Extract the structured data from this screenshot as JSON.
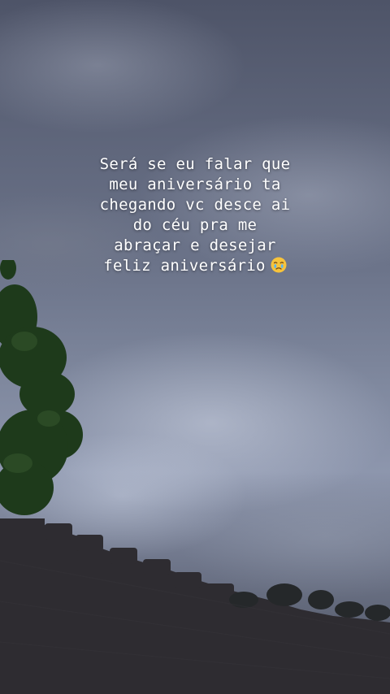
{
  "story": {
    "caption_lines": [
      "Será se eu falar que",
      "meu aniversário ta",
      "chegando vc desce ai",
      "do céu pra me",
      "abraçar e desejar",
      "feliz aniversário"
    ],
    "caption_emoji": "tearful-face-emoji"
  },
  "colors": {
    "sky_top": "#4e5468",
    "sky_mid": "#7f889e",
    "wall": "#2e2c31",
    "tree": "#1f3a1c",
    "caption_text": "#ffffff"
  }
}
